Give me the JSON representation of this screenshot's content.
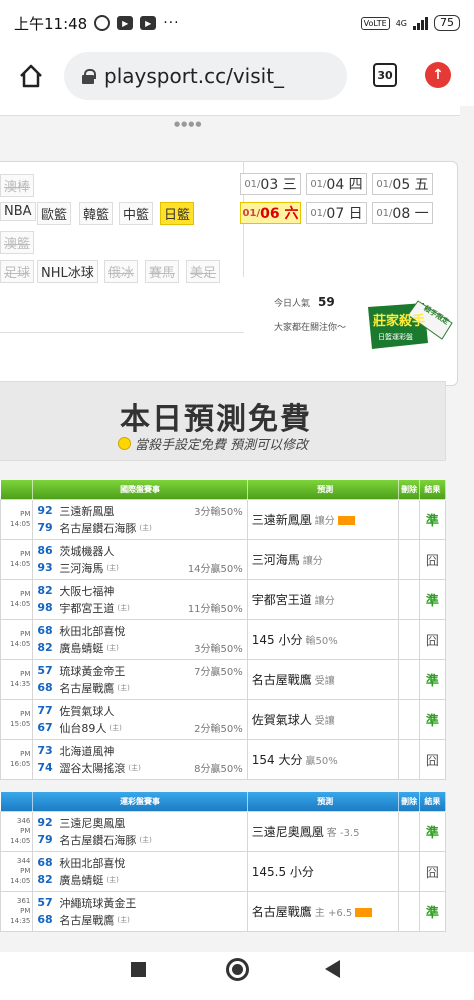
{
  "status": {
    "time": "上午11:48",
    "volte": "VoLTE",
    "network": "4G",
    "battery": "75"
  },
  "browser": {
    "url": "playsport.cc/visit_",
    "tab_count": "30"
  },
  "carousel_dots": "●●●●",
  "sports": [
    {
      "label": "澳棒",
      "state": "dim"
    },
    {
      "label": "NBA",
      "state": "normal"
    },
    {
      "label": "歐籃",
      "state": "normal"
    },
    {
      "label": "韓籃",
      "state": "normal"
    },
    {
      "label": "中籃",
      "state": "normal"
    },
    {
      "label": "日籃",
      "state": "active"
    },
    {
      "label": "澳籃",
      "state": "dim"
    },
    {
      "label": "足球",
      "state": "dim"
    },
    {
      "label": "NHL冰球",
      "state": "normal"
    },
    {
      "label": "俄冰",
      "state": "dim"
    },
    {
      "label": "賽馬",
      "state": "dim"
    },
    {
      "label": "美足",
      "state": "dim"
    }
  ],
  "dates": [
    {
      "m": "01/",
      "d": "03 三",
      "active": false
    },
    {
      "m": "01/",
      "d": "04 四",
      "active": false
    },
    {
      "m": "01/",
      "d": "05 五",
      "active": false
    },
    {
      "m": "01/",
      "d": "06 六",
      "active": true
    },
    {
      "m": "01/",
      "d": "07 日",
      "active": false
    },
    {
      "m": "01/",
      "d": "08 一",
      "active": false
    }
  ],
  "popularity": {
    "label": "今日人氣",
    "value": "59",
    "watching": "大家都在關注你～"
  },
  "badge": {
    "title": "莊家殺手",
    "sub": "日籃運彩盤",
    "ribbon": "殺手限定"
  },
  "promo": {
    "title": "本日預測免費",
    "subtitle": "當殺手設定免費  預測可以修改"
  },
  "table1": {
    "headers": {
      "match": "國際盤賽事",
      "pred": "預測",
      "del": "刪除",
      "res": "結果"
    },
    "rows": [
      {
        "time": "PM 14:05",
        "a_num": "92",
        "a": "三遠新鳳凰",
        "b_num": "79",
        "b": "名古屋鑽石海豚",
        "b_h": "(主)",
        "a_res": "3分輸50%",
        "b_res": "",
        "pred": "三遠新鳳凰",
        "tag": "讓分",
        "hot": true,
        "result": "準",
        "win": true
      },
      {
        "time": "PM 14:05",
        "a_num": "86",
        "a": "茨城機器人",
        "b_num": "93",
        "b": "三河海馬",
        "b_h": "(主)",
        "a_res": "",
        "b_res": "14分贏50%",
        "pred": "三河海馬",
        "tag": "讓分",
        "hot": false,
        "result": "囧",
        "win": false
      },
      {
        "time": "PM 14:05",
        "a_num": "82",
        "a": "大阪七福神",
        "b_num": "98",
        "b": "宇都宮王道",
        "b_h": "(主)",
        "a_res": "",
        "b_res": "11分輸50%",
        "pred": "宇都宮王道",
        "tag": "讓分",
        "hot": false,
        "result": "準",
        "win": true
      },
      {
        "time": "PM 14:05",
        "a_num": "68",
        "a": "秋田北部喜悅",
        "b_num": "82",
        "b": "廣島蜻蜓",
        "b_h": "(主)",
        "a_res": "",
        "b_res": "3分輸50%",
        "pred": "145 小分",
        "tag": "輸50%",
        "hot": false,
        "result": "囧",
        "win": false
      },
      {
        "time": "PM 14:35",
        "a_num": "57",
        "a": "琉球黃金帝王",
        "b_num": "68",
        "b": "名古屋戰鷹",
        "b_h": "(主)",
        "a_res": "7分贏50%",
        "b_res": "",
        "pred": "名古屋戰鷹",
        "tag": "受讓",
        "hot": false,
        "result": "準",
        "win": true
      },
      {
        "time": "PM 15:05",
        "a_num": "77",
        "a": "佐賀氣球人",
        "b_num": "67",
        "b": "仙台89人",
        "b_h": "(主)",
        "a_res": "",
        "b_res": "2分輸50%",
        "pred": "佐賀氣球人",
        "tag": "受讓",
        "hot": false,
        "result": "準",
        "win": true
      },
      {
        "time": "PM 16:05",
        "a_num": "73",
        "a": "北海道風神",
        "b_num": "74",
        "b": "澀谷太陽搖滾",
        "b_h": "(主)",
        "a_res": "",
        "b_res": "8分贏50%",
        "pred": "154 大分",
        "tag": "贏50%",
        "hot": false,
        "result": "囧",
        "win": false
      }
    ]
  },
  "table2": {
    "headers": {
      "match": "運彩盤賽事",
      "pred": "預測",
      "del": "刪除",
      "res": "結果"
    },
    "rows": [
      {
        "code": "346",
        "time": "PM 14:05",
        "a_num": "92",
        "a": "三遠尼奧鳳凰",
        "b_num": "79",
        "b": "名古屋鑽石海豚",
        "b_h": "(主)",
        "pred": "三遠尼奧鳳凰",
        "tag": "客 -3.5",
        "hot": false,
        "result": "準",
        "win": true
      },
      {
        "code": "344",
        "time": "PM 14:05",
        "a_num": "68",
        "a": "秋田北部喜悅",
        "b_num": "82",
        "b": "廣島蜻蜓",
        "b_h": "(主)",
        "pred": "145.5 小分",
        "tag": "",
        "hot": false,
        "result": "囧",
        "win": false
      },
      {
        "code": "361",
        "time": "PM 14:35",
        "a_num": "57",
        "a": "沖繩琉球黃金王",
        "b_num": "68",
        "b": "名古屋戰鷹",
        "b_h": "(主)",
        "pred": "名古屋戰鷹",
        "tag": "主 +6.5",
        "hot": true,
        "result": "準",
        "win": true
      }
    ]
  }
}
